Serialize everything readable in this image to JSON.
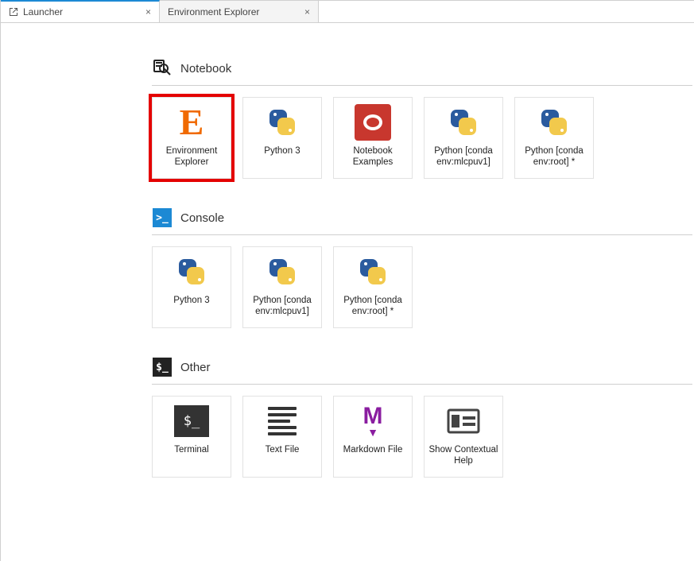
{
  "tabs": [
    {
      "label": "Launcher",
      "active": true
    },
    {
      "label": "Environment Explorer",
      "active": false
    }
  ],
  "sections": {
    "notebook": {
      "title": "Notebook",
      "cards": [
        {
          "label": "Environment Explorer",
          "icon": "orange-e",
          "highlight": true
        },
        {
          "label": "Python 3",
          "icon": "python"
        },
        {
          "label": "Notebook Examples",
          "icon": "red-ring"
        },
        {
          "label": "Python [conda env:mlcpuv1]",
          "icon": "python"
        },
        {
          "label": "Python [conda env:root] *",
          "icon": "python"
        }
      ]
    },
    "console": {
      "title": "Console",
      "cards": [
        {
          "label": "Python 3",
          "icon": "python"
        },
        {
          "label": "Python [conda env:mlcpuv1]",
          "icon": "python"
        },
        {
          "label": "Python [conda env:root] *",
          "icon": "python"
        }
      ]
    },
    "other": {
      "title": "Other",
      "cards": [
        {
          "label": "Terminal",
          "icon": "terminal"
        },
        {
          "label": "Text File",
          "icon": "textfile"
        },
        {
          "label": "Markdown File",
          "icon": "markdown"
        },
        {
          "label": "Show Contextual Help",
          "icon": "contextual-help"
        }
      ]
    }
  }
}
